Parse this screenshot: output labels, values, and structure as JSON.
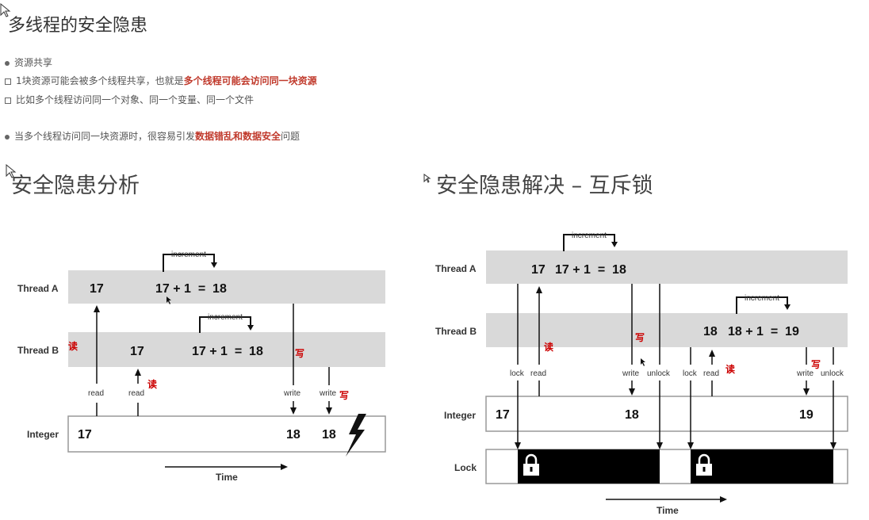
{
  "page": {
    "title": "多线程的安全隐患",
    "bullets": [
      {
        "parts": [
          "资源共享"
        ]
      },
      {
        "parts": [
          "1块资源可能会被多个线程共享，也就是",
          "多个线程可能会访问同一块资源",
          ""
        ]
      },
      {
        "parts": [
          "比如多个线程访问同一个对象、同一个变量、同一个文件"
        ]
      },
      {
        "parts": [
          "当多个线程访问同一块资源时，很容易引发",
          "数据错乱和数据安全",
          "问题"
        ]
      }
    ],
    "left_heading": "安全隐患分析",
    "right_heading": "安全隐患解决  –  互斥锁"
  },
  "left_diagram": {
    "thread_a": "Thread A",
    "thread_b": "Thread B",
    "integer": "Integer",
    "time": "Time",
    "a_value": "17",
    "a_expr": "17 + 1  =  18",
    "b_value": "17",
    "b_expr": "17 + 1  =  18",
    "increment": "increment",
    "read": "read",
    "write": "write",
    "int_start": "17",
    "int_v1": "18",
    "int_v2": "18",
    "ann_read": "读",
    "ann_write": "写"
  },
  "right_diagram": {
    "thread_a": "Thread A",
    "thread_b": "Thread B",
    "integer": "Integer",
    "lock": "Lock",
    "time": "Time",
    "a_value": "17",
    "a_expr": "17 + 1  =  18",
    "b_value": "18",
    "b_expr": "18 + 1  =  19",
    "increment": "increment",
    "lock_lbl": "lock",
    "unlock_lbl": "unlock",
    "read": "read",
    "write": "write",
    "int_start": "17",
    "int_v1": "18",
    "int_v2": "19",
    "ann_read": "读",
    "ann_write": "写"
  }
}
